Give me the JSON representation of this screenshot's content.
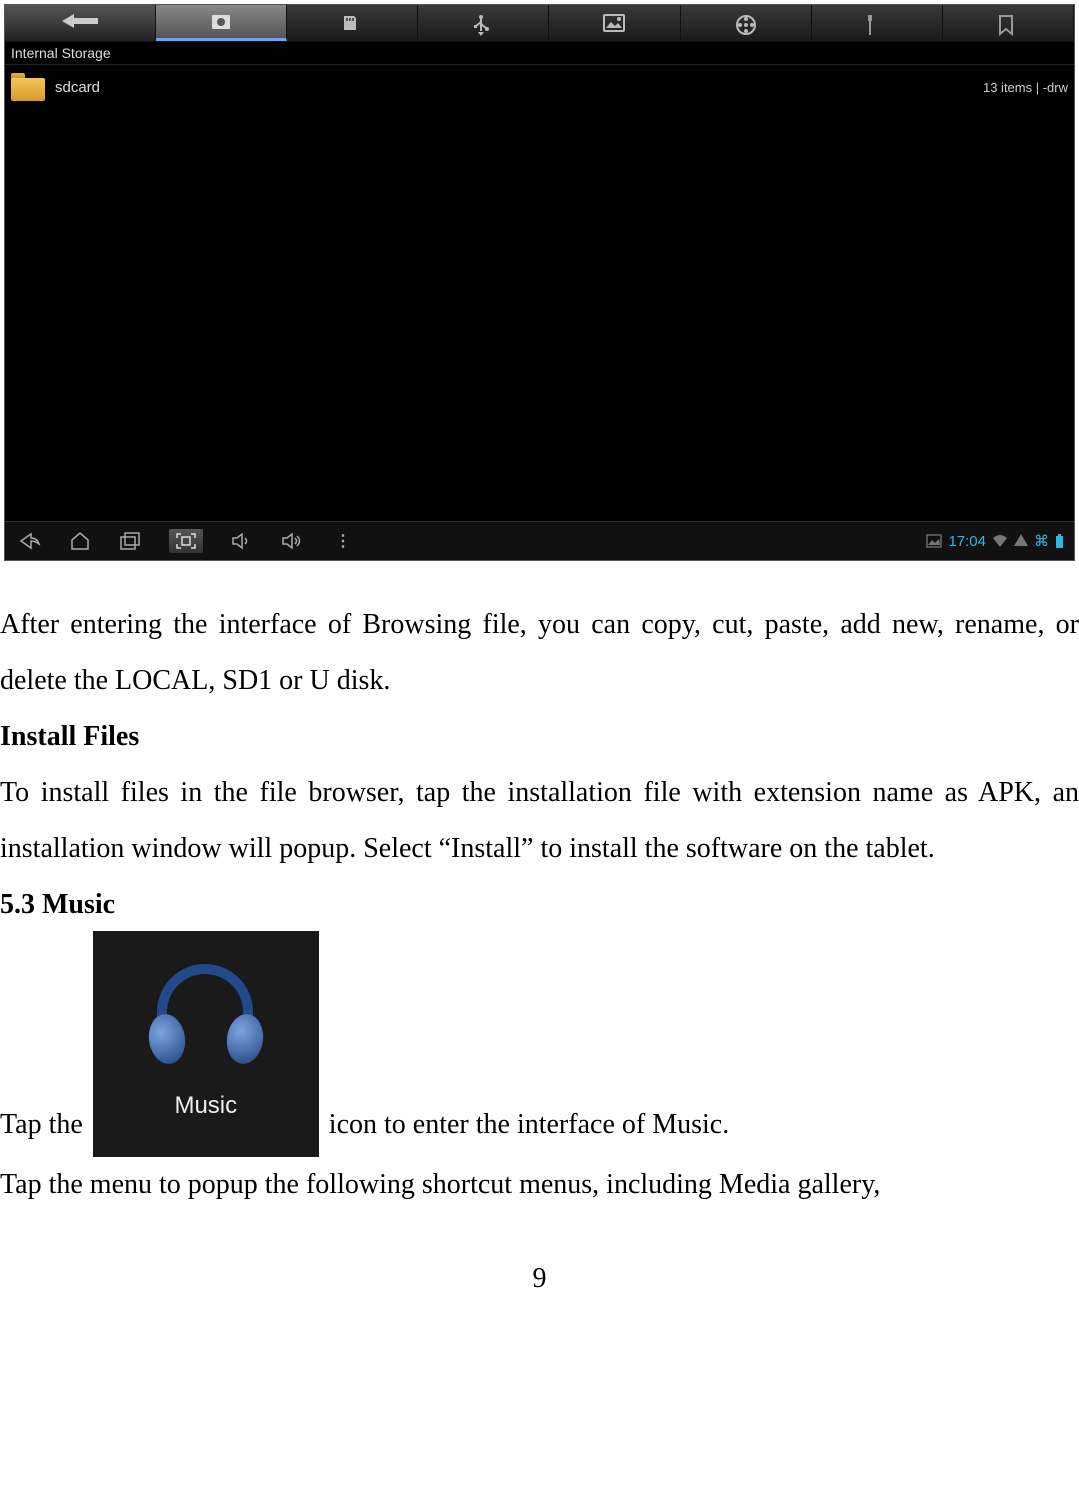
{
  "screenshot": {
    "breadcrumb": "Internal Storage",
    "file": {
      "name": "sdcard",
      "meta": "13 items | -drw"
    },
    "toolbar": {
      "back_icon": "back-arrow-icon",
      "tabs": [
        {
          "name": "storage-tab",
          "icon": "disk-icon"
        },
        {
          "name": "sd-tab",
          "icon": "sd-card-icon"
        },
        {
          "name": "usb-tab",
          "icon": "usb-icon"
        },
        {
          "name": "pictures-tab",
          "icon": "picture-icon"
        },
        {
          "name": "movies-tab",
          "icon": "film-reel-icon"
        },
        {
          "name": "tools-tab",
          "icon": "tool-icon"
        },
        {
          "name": "tag-tab",
          "icon": "tag-icon"
        }
      ],
      "active_index": 0
    },
    "navbar": {
      "left": [
        "back-icon",
        "home-icon",
        "recents-icon",
        "capture-icon",
        "volume-down-icon",
        "volume-up-icon",
        "overflow-icon"
      ],
      "right": {
        "gallery": "gallery-status-icon",
        "time": "17:04",
        "wifi": "wifi-icon",
        "signal": "signal-icon",
        "bluetooth": "bluetooth-icon",
        "battery": "battery-icon"
      }
    }
  },
  "doc": {
    "p1": "After entering the interface of Browsing file, you can copy, cut, paste, add new, rename, or delete the LOCAL, SD1 or U disk.",
    "h1": "Install Files",
    "p2": "To install files in the file browser, tap the installation file with extension name as APK, an installation window will popup. Select “Install” to install the software on the tablet.",
    "h2": "5.3 Music",
    "music_tap_pre": "Tap the",
    "music_label": "Music",
    "music_tap_post": " icon to enter the interface of Music.",
    "p3": "Tap the menu to popup the following shortcut menus, including Media gallery,",
    "page_number": "9"
  }
}
